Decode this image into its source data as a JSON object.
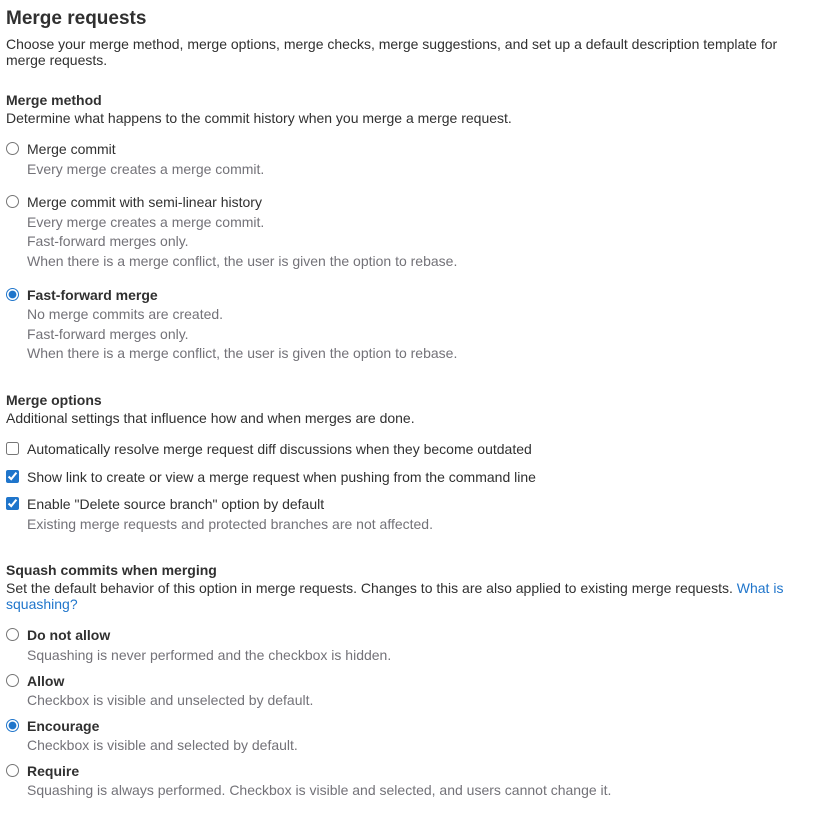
{
  "page": {
    "title": "Merge requests",
    "description": "Choose your merge method, merge options, merge checks, merge suggestions, and set up a default description template for merge requests."
  },
  "merge_method": {
    "heading": "Merge method",
    "description": "Determine what happens to the commit history when you merge a merge request.",
    "options": [
      {
        "label": "Merge commit",
        "help": [
          "Every merge creates a merge commit."
        ],
        "checked": false
      },
      {
        "label": "Merge commit with semi-linear history",
        "help": [
          "Every merge creates a merge commit.",
          "Fast-forward merges only.",
          "When there is a merge conflict, the user is given the option to rebase."
        ],
        "checked": false
      },
      {
        "label": "Fast-forward merge",
        "help": [
          "No merge commits are created.",
          "Fast-forward merges only.",
          "When there is a merge conflict, the user is given the option to rebase."
        ],
        "checked": true
      }
    ]
  },
  "merge_options": {
    "heading": "Merge options",
    "description": "Additional settings that influence how and when merges are done.",
    "items": [
      {
        "label": "Automatically resolve merge request diff discussions when they become outdated",
        "help": [],
        "checked": false
      },
      {
        "label": "Show link to create or view a merge request when pushing from the command line",
        "help": [],
        "checked": true
      },
      {
        "label": "Enable \"Delete source branch\" option by default",
        "help": [
          "Existing merge requests and protected branches are not affected."
        ],
        "checked": true
      }
    ]
  },
  "squash": {
    "heading": "Squash commits when merging",
    "description": "Set the default behavior of this option in merge requests. Changes to this are also applied to existing merge requests. ",
    "link_text": "What is squashing?",
    "options": [
      {
        "label": "Do not allow",
        "help": "Squashing is never performed and the checkbox is hidden.",
        "checked": false
      },
      {
        "label": "Allow",
        "help": "Checkbox is visible and unselected by default.",
        "checked": false
      },
      {
        "label": "Encourage",
        "help": "Checkbox is visible and selected by default.",
        "checked": true
      },
      {
        "label": "Require",
        "help": "Squashing is always performed. Checkbox is visible and selected, and users cannot change it.",
        "checked": false
      }
    ]
  }
}
